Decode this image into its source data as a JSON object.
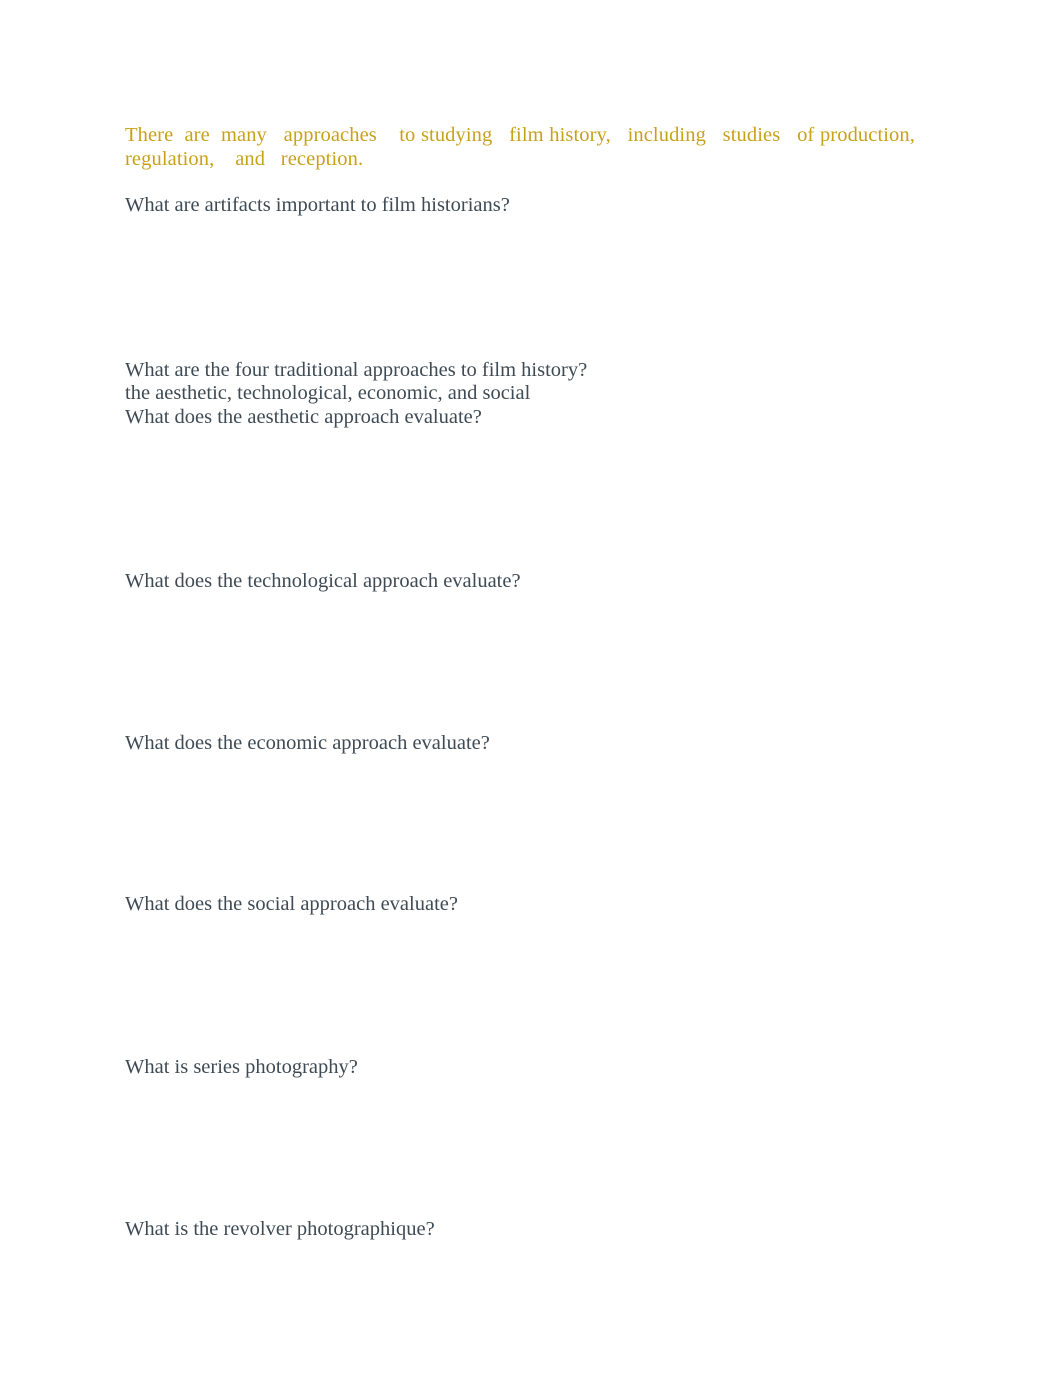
{
  "document": {
    "page_background": "#ffffff",
    "highlight_color": "#c8a11b",
    "body_text_color": "#3e4a54",
    "intro": "There  are  many   approaches    to studying   film history,   including   studies   of production,  regulation,    and   reception.",
    "questions": [
      {
        "id": "q1",
        "text": "What are artifacts important to film historians?",
        "answer": ""
      },
      {
        "id": "q2",
        "text": "What are the four traditional approaches to film history?",
        "answer": "the aesthetic, technological, economic, and social"
      },
      {
        "id": "q3",
        "text": "What does the aesthetic approach evaluate?",
        "answer": ""
      },
      {
        "id": "q4",
        "text": "What does the technological approach evaluate?",
        "answer": ""
      },
      {
        "id": "q5",
        "text": "What does the economic approach evaluate?",
        "answer": ""
      },
      {
        "id": "q6",
        "text": "What does the social approach evaluate?",
        "answer": ""
      },
      {
        "id": "q7",
        "text": "What is series photography?",
        "answer": ""
      },
      {
        "id": "q8",
        "text": "What is the revolver photographique?",
        "answer": ""
      }
    ]
  }
}
